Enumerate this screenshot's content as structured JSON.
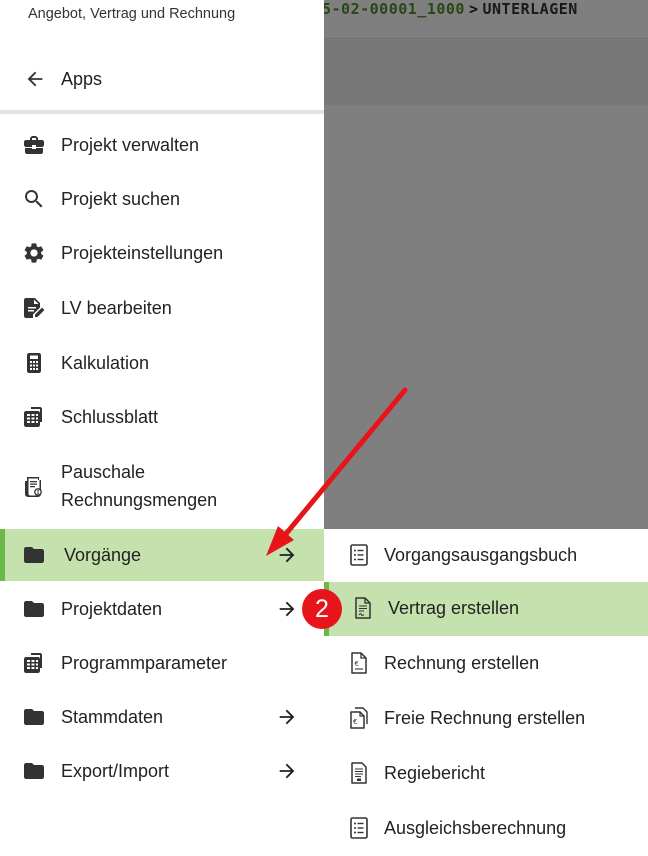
{
  "background": {
    "breadcrumb_code": "5-02-00001_1000",
    "breadcrumb_separator": ">",
    "breadcrumb_current": "UNTERLAGEN"
  },
  "drawer": {
    "subtitle": "Angebot, Vertrag und Rechnung",
    "back_label": "Apps",
    "items": [
      {
        "label": "Projekt verwalten",
        "icon": "briefcase-icon"
      },
      {
        "label": "Projekt suchen",
        "icon": "search-icon"
      },
      {
        "label": "Projekteinstellungen",
        "icon": "gear-icon"
      },
      {
        "label": "LV bearbeiten",
        "icon": "document-edit-icon"
      },
      {
        "label": "Kalkulation",
        "icon": "calculator-icon"
      },
      {
        "label": "Schlussblatt",
        "icon": "sheet-calculator-icon"
      },
      {
        "label": "Pauschale Rechnungsmengen",
        "label_line1": "Pauschale",
        "label_line2": "Rechnungsmengen",
        "icon": "receipt-icon"
      },
      {
        "label": "Vorgänge",
        "icon": "folder-icon",
        "active": true,
        "has_submenu": true
      },
      {
        "label": "Projektdaten",
        "icon": "folder-icon",
        "has_submenu": true
      },
      {
        "label": "Programmparameter",
        "icon": "sheet-calculator-icon"
      },
      {
        "label": "Stammdaten",
        "icon": "folder-icon",
        "has_submenu": true
      },
      {
        "label": "Export/Import",
        "icon": "folder-icon",
        "has_submenu": true
      }
    ]
  },
  "submenu": {
    "items": [
      {
        "label": "Vorgangsausgangsbuch",
        "icon": "list-document-icon"
      },
      {
        "label": "Vertrag erstellen",
        "icon": "contract-document-icon",
        "active": true
      },
      {
        "label": "Rechnung erstellen",
        "icon": "invoice-document-icon"
      },
      {
        "label": "Freie Rechnung erstellen",
        "icon": "free-invoice-icon"
      },
      {
        "label": "Regiebericht",
        "icon": "report-document-icon"
      },
      {
        "label": "Ausgleichsberechnung",
        "icon": "list-document-icon"
      }
    ]
  },
  "annotation": {
    "step_number": "2"
  },
  "colors": {
    "active_background": "#c5e2ae",
    "active_indicator": "#6ab84a",
    "breadcrumb_green": "#4f8f2f",
    "annotation_red": "#e8141b"
  }
}
